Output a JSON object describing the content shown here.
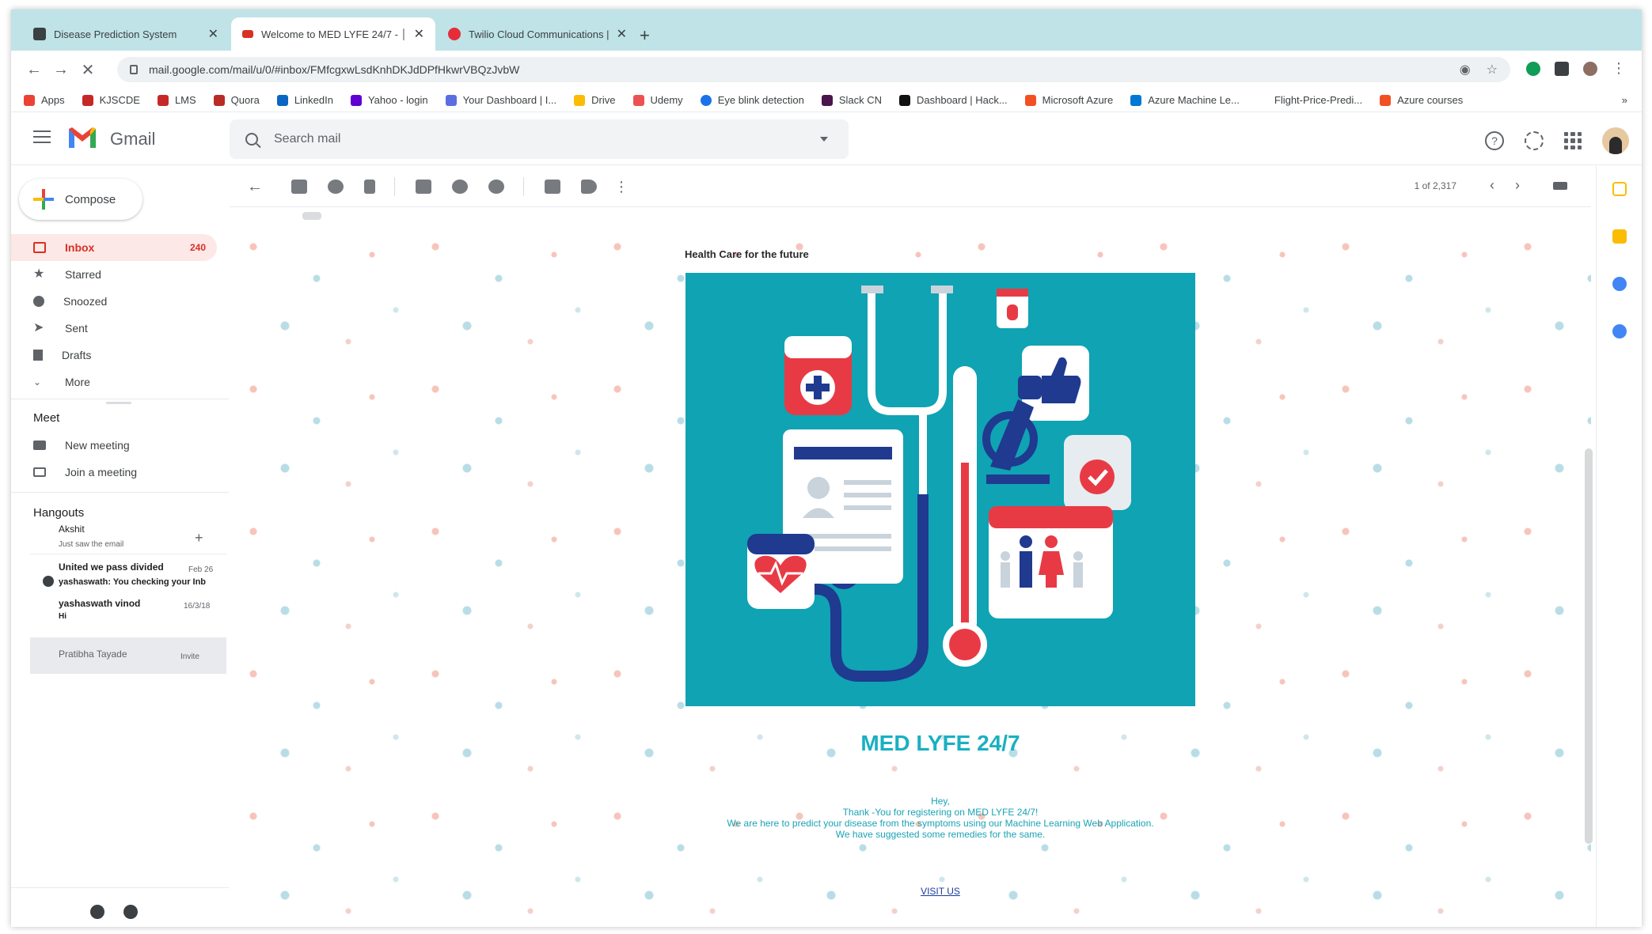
{
  "browser": {
    "tabs": [
      {
        "title": "Disease Prediction System",
        "active": false,
        "color": "#3c4043"
      },
      {
        "title": "Welcome to MED LYFE 24/7 - │",
        "active": true,
        "color": "#d93025"
      },
      {
        "title": "Twilio Cloud Communications |",
        "active": false,
        "color": "#e52d3a"
      }
    ],
    "url": "mail.google.com/mail/u/0/#inbox/FMfcgxwLsdKnhDKJdDPfHkwrVBQzJvbW",
    "bookmarks": [
      {
        "label": "Apps",
        "color": "#ea4335"
      },
      {
        "label": "KJSCDE",
        "color": "#c62828"
      },
      {
        "label": "LMS",
        "color": "#c62828"
      },
      {
        "label": "Quora",
        "color": "#b92b27"
      },
      {
        "label": "LinkedIn",
        "color": "#0a66c2"
      },
      {
        "label": "Yahoo - login",
        "color": "#6001d2"
      },
      {
        "label": "Your Dashboard | I...",
        "color": "#5b6ee1"
      },
      {
        "label": "Drive",
        "color": "#fbbc04"
      },
      {
        "label": "Udemy",
        "color": "#ec5252"
      },
      {
        "label": "Eye blink detection",
        "color": "#1a73e8"
      },
      {
        "label": "Slack CN",
        "color": "#4a154b"
      },
      {
        "label": "Dashboard | Hack...",
        "color": "#111111"
      },
      {
        "label": "Microsoft Azure",
        "color": "#f25022"
      },
      {
        "label": "Azure Machine Le...",
        "color": "#0078d4"
      },
      {
        "label": "Flight-Price-Predi...",
        "color": "#ffffff"
      },
      {
        "label": "Azure courses",
        "color": "#f25022"
      }
    ],
    "bookmarks_more": "»"
  },
  "gmail": {
    "product_name": "Gmail",
    "search_placeholder": "Search mail",
    "compose_label": "Compose",
    "nav": [
      {
        "label": "Inbox",
        "count": "240",
        "active": true,
        "icon": "inbox-icon"
      },
      {
        "label": "Starred",
        "count": "",
        "active": false,
        "icon": "star-icon"
      },
      {
        "label": "Snoozed",
        "count": "",
        "active": false,
        "icon": "clock-icon"
      },
      {
        "label": "Sent",
        "count": "",
        "active": false,
        "icon": "send-icon"
      },
      {
        "label": "Drafts",
        "count": "",
        "active": false,
        "icon": "draft-icon"
      },
      {
        "label": "More",
        "count": "",
        "active": false,
        "icon": "chevron-down-icon"
      }
    ],
    "meet": {
      "title": "Meet",
      "new_meeting": "New meeting",
      "join_meeting": "Join a meeting"
    },
    "hangouts": {
      "title": "Hangouts",
      "user_name": "Akshit",
      "user_status": "Just saw the email",
      "add_symbol": "+",
      "chats": [
        {
          "title": "United we pass divided",
          "time": "Feb 26",
          "preview": "yashaswath: You checking your Inb"
        },
        {
          "title": "yashaswath vinod",
          "time": "16/3/18",
          "preview": "Hi"
        },
        {
          "title": "Pratibha Tayade",
          "time": "Invite",
          "preview": ""
        }
      ]
    },
    "pager_text": "1 of 2,317",
    "email": {
      "tagline": "Health Care for the future",
      "brand": "MED LYFE 24/7",
      "line1": "Hey,",
      "line2": "Thank -You for registering on MED LYFE 24/7!",
      "line3": "We are here to predict your disease from the symptoms using our Machine Learning Web Application.",
      "line4": "We have suggested some remedies for the same.",
      "cta": "VISIT US"
    }
  },
  "colors": {
    "accent_red": "#d93025",
    "hero_teal": "#0fa3b3",
    "brand_teal": "#1ab0c1",
    "tabstrip": "#bfe3e6"
  }
}
